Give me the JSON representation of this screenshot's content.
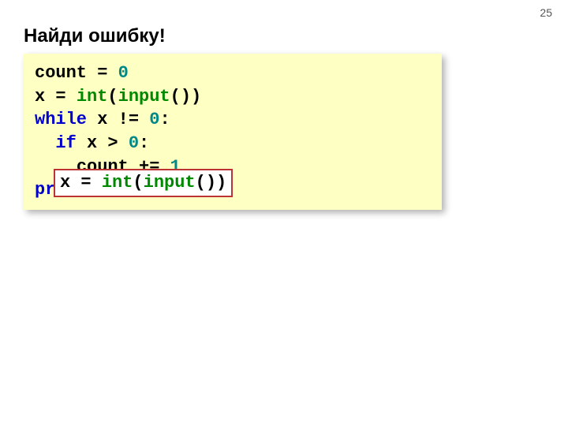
{
  "page_number": "25",
  "title": "Найди ошибку!",
  "code": {
    "line1": {
      "a": "count ",
      "eq": "=",
      "sp": " ",
      "val": "0"
    },
    "line2": {
      "a": "x ",
      "eq": "=",
      "sp": " ",
      "fn": "int",
      "paren": "(",
      "inp": "input",
      "rest": "())"
    },
    "line3": {
      "kw": "while",
      "a": " x ",
      "op": "!=",
      "sp": " ",
      "val": "0",
      "colon": ":"
    },
    "line4": {
      "indent": "  ",
      "kw": "if",
      "a": " x ",
      "op": ">",
      "sp": " ",
      "val": "0",
      "colon": ":"
    },
    "line5": {
      "indent": "    ",
      "a": "count ",
      "op": "+=",
      "sp": " ",
      "val": "1"
    },
    "line6": {
      "kw": "pr"
    }
  },
  "correction": {
    "a": "x ",
    "eq": "=",
    "sp": " ",
    "fn": "int",
    "paren": "(",
    "inp": "input",
    "rest": "())"
  }
}
